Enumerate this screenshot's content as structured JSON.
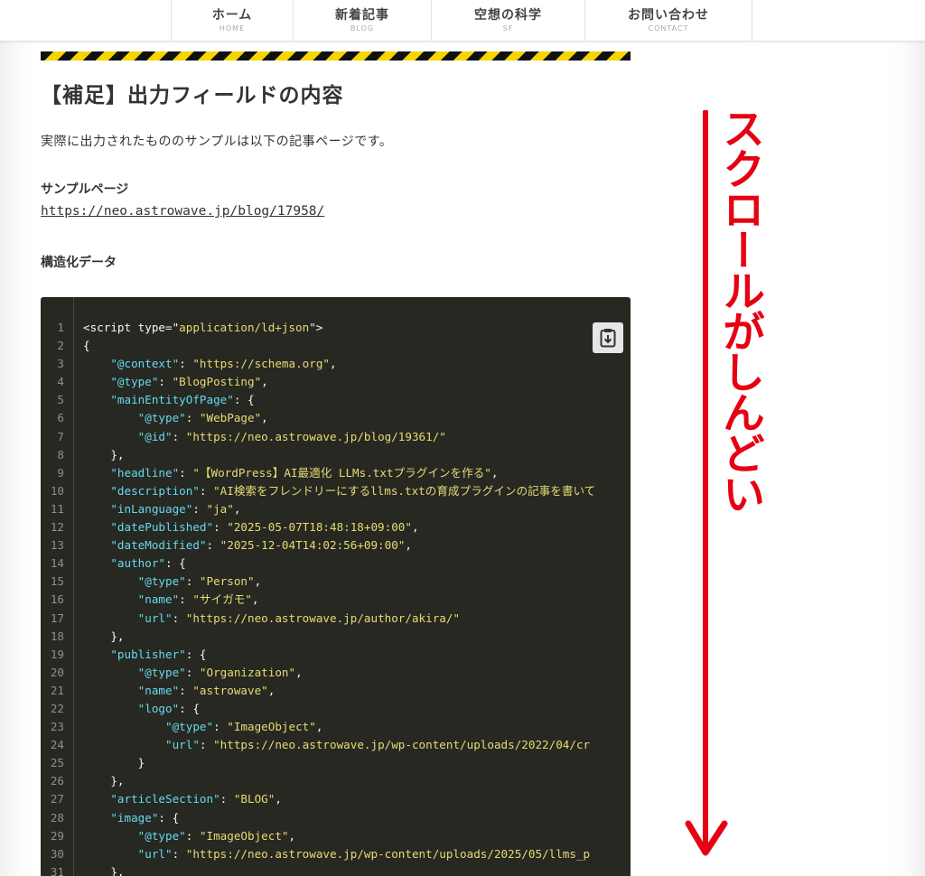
{
  "nav": {
    "items": [
      {
        "label": "ホーム",
        "sub": "HOME"
      },
      {
        "label": "新着記事",
        "sub": "BLOG"
      },
      {
        "label": "空想の科学",
        "sub": "SF"
      },
      {
        "label": "お問い合わせ",
        "sub": "CONTACT"
      }
    ]
  },
  "article": {
    "heading": "【補足】出力フィールドの内容",
    "intro": "実際に出力されたもののサンプルは以下の記事ページです。",
    "sample_title": "サンプルページ",
    "sample_link": "https://neo.astrowave.jp/blog/17958/",
    "struct_title": "構造化データ"
  },
  "code": {
    "lines": [
      [
        [
          "p",
          "<script type=\""
        ],
        [
          "s",
          "application/ld+json"
        ],
        [
          "p",
          "\">"
        ]
      ],
      [
        [
          "p",
          "{"
        ]
      ],
      [
        [
          "p",
          "    "
        ],
        [
          "k",
          "\"@context\""
        ],
        [
          "p",
          ": "
        ],
        [
          "s",
          "\"https://schema.org\""
        ],
        [
          "p",
          ","
        ]
      ],
      [
        [
          "p",
          "    "
        ],
        [
          "k",
          "\"@type\""
        ],
        [
          "p",
          ": "
        ],
        [
          "s",
          "\"BlogPosting\""
        ],
        [
          "p",
          ","
        ]
      ],
      [
        [
          "p",
          "    "
        ],
        [
          "k",
          "\"mainEntityOfPage\""
        ],
        [
          "p",
          ": {"
        ]
      ],
      [
        [
          "p",
          "        "
        ],
        [
          "k",
          "\"@type\""
        ],
        [
          "p",
          ": "
        ],
        [
          "s",
          "\"WebPage\""
        ],
        [
          "p",
          ","
        ]
      ],
      [
        [
          "p",
          "        "
        ],
        [
          "k",
          "\"@id\""
        ],
        [
          "p",
          ": "
        ],
        [
          "s",
          "\"https://neo.astrowave.jp/blog/19361/\""
        ]
      ],
      [
        [
          "p",
          "    },"
        ]
      ],
      [
        [
          "p",
          "    "
        ],
        [
          "k",
          "\"headline\""
        ],
        [
          "p",
          ": "
        ],
        [
          "s",
          "\"【WordPress】AI最適化 LLMs.txtプラグインを作る\""
        ],
        [
          "p",
          ","
        ]
      ],
      [
        [
          "p",
          "    "
        ],
        [
          "k",
          "\"description\""
        ],
        [
          "p",
          ": "
        ],
        [
          "s",
          "\"AI検索をフレンドリーにするllms.txtの育成プラグインの記事を書いて"
        ]
      ],
      [
        [
          "p",
          "    "
        ],
        [
          "k",
          "\"inLanguage\""
        ],
        [
          "p",
          ": "
        ],
        [
          "s",
          "\"ja\""
        ],
        [
          "p",
          ","
        ]
      ],
      [
        [
          "p",
          "    "
        ],
        [
          "k",
          "\"datePublished\""
        ],
        [
          "p",
          ": "
        ],
        [
          "s",
          "\"2025-05-07T18:48:18+09:00\""
        ],
        [
          "p",
          ","
        ]
      ],
      [
        [
          "p",
          "    "
        ],
        [
          "k",
          "\"dateModified\""
        ],
        [
          "p",
          ": "
        ],
        [
          "s",
          "\"2025-12-04T14:02:56+09:00\""
        ],
        [
          "p",
          ","
        ]
      ],
      [
        [
          "p",
          "    "
        ],
        [
          "k",
          "\"author\""
        ],
        [
          "p",
          ": {"
        ]
      ],
      [
        [
          "p",
          "        "
        ],
        [
          "k",
          "\"@type\""
        ],
        [
          "p",
          ": "
        ],
        [
          "s",
          "\"Person\""
        ],
        [
          "p",
          ","
        ]
      ],
      [
        [
          "p",
          "        "
        ],
        [
          "k",
          "\"name\""
        ],
        [
          "p",
          ": "
        ],
        [
          "s",
          "\"サイガモ\""
        ],
        [
          "p",
          ","
        ]
      ],
      [
        [
          "p",
          "        "
        ],
        [
          "k",
          "\"url\""
        ],
        [
          "p",
          ": "
        ],
        [
          "s",
          "\"https://neo.astrowave.jp/author/akira/\""
        ]
      ],
      [
        [
          "p",
          "    },"
        ]
      ],
      [
        [
          "p",
          "    "
        ],
        [
          "k",
          "\"publisher\""
        ],
        [
          "p",
          ": {"
        ]
      ],
      [
        [
          "p",
          "        "
        ],
        [
          "k",
          "\"@type\""
        ],
        [
          "p",
          ": "
        ],
        [
          "s",
          "\"Organization\""
        ],
        [
          "p",
          ","
        ]
      ],
      [
        [
          "p",
          "        "
        ],
        [
          "k",
          "\"name\""
        ],
        [
          "p",
          ": "
        ],
        [
          "s",
          "\"astrowave\""
        ],
        [
          "p",
          ","
        ]
      ],
      [
        [
          "p",
          "        "
        ],
        [
          "k",
          "\"logo\""
        ],
        [
          "p",
          ": {"
        ]
      ],
      [
        [
          "p",
          "            "
        ],
        [
          "k",
          "\"@type\""
        ],
        [
          "p",
          ": "
        ],
        [
          "s",
          "\"ImageObject\""
        ],
        [
          "p",
          ","
        ]
      ],
      [
        [
          "p",
          "            "
        ],
        [
          "k",
          "\"url\""
        ],
        [
          "p",
          ": "
        ],
        [
          "s",
          "\"https://neo.astrowave.jp/wp-content/uploads/2022/04/cr"
        ]
      ],
      [
        [
          "p",
          "        }"
        ]
      ],
      [
        [
          "p",
          "    },"
        ]
      ],
      [
        [
          "p",
          "    "
        ],
        [
          "k",
          "\"articleSection\""
        ],
        [
          "p",
          ": "
        ],
        [
          "s",
          "\"BLOG\""
        ],
        [
          "p",
          ","
        ]
      ],
      [
        [
          "p",
          "    "
        ],
        [
          "k",
          "\"image\""
        ],
        [
          "p",
          ": {"
        ]
      ],
      [
        [
          "p",
          "        "
        ],
        [
          "k",
          "\"@type\""
        ],
        [
          "p",
          ": "
        ],
        [
          "s",
          "\"ImageObject\""
        ],
        [
          "p",
          ","
        ]
      ],
      [
        [
          "p",
          "        "
        ],
        [
          "k",
          "\"url\""
        ],
        [
          "p",
          ": "
        ],
        [
          "s",
          "\"https://neo.astrowave.jp/wp-content/uploads/2025/05/llms_p"
        ]
      ],
      [
        [
          "p",
          "    },"
        ]
      ]
    ],
    "copy_icon": "clipboard-copy-icon"
  },
  "annotation": {
    "text": "スクロールがしんどい",
    "color": "#e60012",
    "arrow_icon": "down-arrow-icon"
  },
  "colors": {
    "code_bg": "#272822",
    "key": "#66d9ef",
    "string": "#e6db74",
    "hazard_yellow": "#f5d400"
  }
}
